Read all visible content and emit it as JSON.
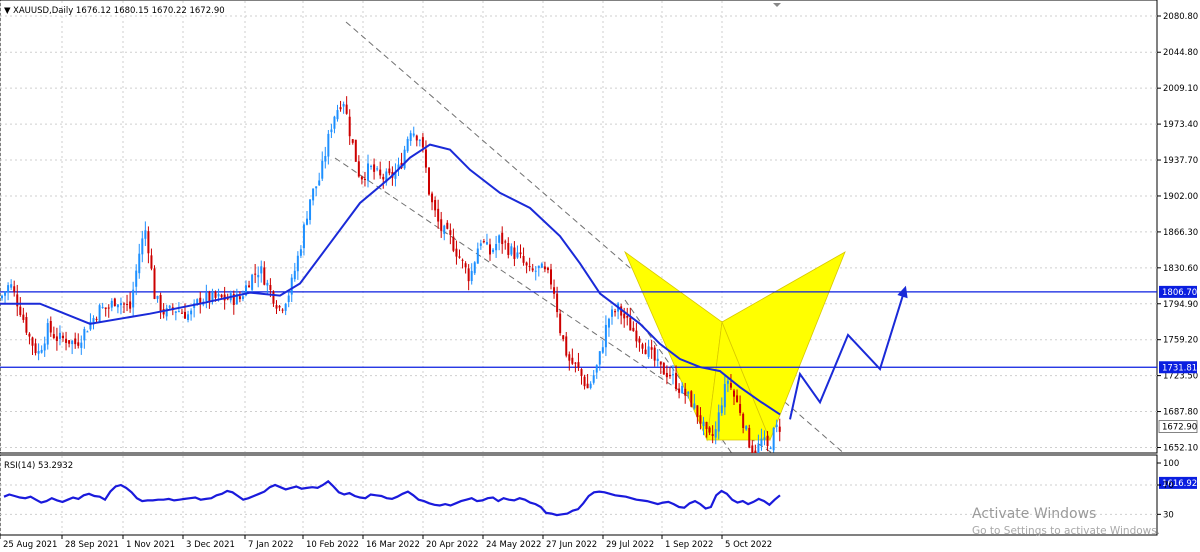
{
  "header": {
    "symbol_line": "XAUUSD,Daily  1676.12 1680.15 1670.22 1672.90",
    "rsi_line": "RSI(14) 53.2932"
  },
  "watermark": {
    "line1": "Activate Windows",
    "line2": "Go to Settings to activate Windows."
  },
  "colors": {
    "bull": "#1e90ff",
    "bear": "#cc0000",
    "ma": "#1a2ad8",
    "hline": "#0a1ee0",
    "pattern": "#ffff00",
    "rsi": "#1a1adc",
    "projection": "#1a2ad8",
    "channel": "#707070"
  },
  "chart_data": [
    {
      "type": "candlestick",
      "symbol": "XAUUSD",
      "timeframe": "Daily",
      "ohlc_last": {
        "open": 1676.12,
        "high": 1680.15,
        "low": 1670.22,
        "close": 1672.9
      },
      "ylim": [
        1616.92,
        2080.8
      ],
      "y_ticks": [
        "2080.80",
        "2044.80",
        "2009.10",
        "1973.40",
        "1937.70",
        "1902.00",
        "1866.30",
        "1830.60",
        "1794.90",
        "1759.20",
        "1723.50",
        "1687.80",
        "1652.10"
      ],
      "x_ticks": [
        "25 Aug 2021",
        "28 Sep 2021",
        "1 Nov 2021",
        "3 Dec 2021",
        "7 Jan 2022",
        "10 Feb 2022",
        "16 Mar 2022",
        "20 Apr 2022",
        "24 May 2022",
        "27 Jun 2022",
        "29 Jul 2022",
        "1 Sep 2022",
        "5 Oct 2022"
      ],
      "close_path": [
        [
          0,
          1800
        ],
        [
          10,
          1815
        ],
        [
          20,
          1790
        ],
        [
          30,
          1760
        ],
        [
          38,
          1745
        ],
        [
          48,
          1770
        ],
        [
          58,
          1760
        ],
        [
          66,
          1760
        ],
        [
          76,
          1755
        ],
        [
          88,
          1773
        ],
        [
          100,
          1790
        ],
        [
          108,
          1790
        ],
        [
          116,
          1800
        ],
        [
          130,
          1790
        ],
        [
          140,
          1850
        ],
        [
          146,
          1870
        ],
        [
          155,
          1800
        ],
        [
          165,
          1785
        ],
        [
          175,
          1790
        ],
        [
          190,
          1783
        ],
        [
          200,
          1800
        ],
        [
          220,
          1800
        ],
        [
          240,
          1800
        ],
        [
          250,
          1820
        ],
        [
          260,
          1830
        ],
        [
          270,
          1808
        ],
        [
          280,
          1790
        ],
        [
          290,
          1808
        ],
        [
          300,
          1850
        ],
        [
          310,
          1900
        ],
        [
          320,
          1920
        ],
        [
          333,
          1980
        ],
        [
          343,
          2000
        ],
        [
          350,
          1965
        ],
        [
          360,
          1920
        ],
        [
          370,
          1930
        ],
        [
          380,
          1920
        ],
        [
          390,
          1920
        ],
        [
          400,
          1930
        ],
        [
          410,
          1970
        ],
        [
          420,
          1960
        ],
        [
          425,
          1935
        ],
        [
          430,
          1900
        ],
        [
          440,
          1870
        ],
        [
          450,
          1860
        ],
        [
          460,
          1840
        ],
        [
          470,
          1820
        ],
        [
          480,
          1860
        ],
        [
          490,
          1845
        ],
        [
          500,
          1860
        ],
        [
          510,
          1848
        ],
        [
          520,
          1840
        ],
        [
          530,
          1825
        ],
        [
          540,
          1830
        ],
        [
          550,
          1820
        ],
        [
          555,
          1805
        ],
        [
          560,
          1770
        ],
        [
          568,
          1740
        ],
        [
          578,
          1730
        ],
        [
          588,
          1710
        ],
        [
          598,
          1735
        ],
        [
          608,
          1780
        ],
        [
          618,
          1790
        ],
        [
          628,
          1775
        ],
        [
          640,
          1760
        ],
        [
          650,
          1745
        ],
        [
          660,
          1730
        ],
        [
          670,
          1725
        ],
        [
          680,
          1710
        ],
        [
          690,
          1700
        ],
        [
          700,
          1680
        ],
        [
          708,
          1660
        ],
        [
          715,
          1665
        ],
        [
          722,
          1700
        ],
        [
          728,
          1720
        ],
        [
          735,
          1700
        ],
        [
          740,
          1690
        ],
        [
          748,
          1660
        ],
        [
          755,
          1645
        ],
        [
          762,
          1660
        ],
        [
          768,
          1650
        ],
        [
          775,
          1670
        ],
        [
          780,
          1672.9
        ]
      ],
      "moving_average_path": [
        [
          0,
          1795
        ],
        [
          40,
          1795
        ],
        [
          90,
          1775
        ],
        [
          150,
          1785
        ],
        [
          200,
          1795
        ],
        [
          250,
          1806
        ],
        [
          280,
          1803
        ],
        [
          300,
          1815
        ],
        [
          330,
          1855
        ],
        [
          360,
          1895
        ],
        [
          390,
          1920
        ],
        [
          410,
          1940
        ],
        [
          430,
          1953
        ],
        [
          450,
          1948
        ],
        [
          470,
          1928
        ],
        [
          500,
          1905
        ],
        [
          530,
          1890
        ],
        [
          560,
          1862
        ],
        [
          580,
          1835
        ],
        [
          600,
          1805
        ],
        [
          620,
          1790
        ],
        [
          640,
          1775
        ],
        [
          660,
          1755
        ],
        [
          680,
          1740
        ],
        [
          700,
          1732
        ],
        [
          720,
          1728
        ],
        [
          740,
          1712
        ],
        [
          760,
          1698
        ],
        [
          780,
          1685
        ]
      ],
      "horizontal_levels": [
        1806.7,
        1731.81,
        1616.92
      ],
      "pattern": "bearish bat / harmonic (yellow)",
      "projection_path": [
        [
          790,
          1680
        ],
        [
          800,
          1725
        ],
        [
          820,
          1697
        ],
        [
          848,
          1764
        ],
        [
          880,
          1730
        ],
        [
          905,
          1810
        ]
      ]
    },
    {
      "type": "line",
      "name": "RSI(14)",
      "last_value": 53.2932,
      "ylim": [
        20,
        100
      ],
      "y_ticks": [
        "100",
        "70",
        "30"
      ],
      "values": [
        54,
        57,
        55,
        53,
        52,
        54,
        50,
        46,
        48,
        52,
        49,
        47,
        50,
        53,
        51,
        56,
        58,
        55,
        54,
        50,
        61,
        68,
        70,
        66,
        60,
        52,
        48,
        49,
        49,
        50,
        50,
        51,
        49,
        50,
        51,
        52,
        53,
        50,
        51,
        52,
        56,
        58,
        62,
        60,
        55,
        50,
        52,
        55,
        58,
        61,
        67,
        70,
        67,
        64,
        66,
        68,
        65,
        66,
        67,
        66,
        70,
        75,
        68,
        60,
        57,
        59,
        55,
        53,
        52,
        57,
        56,
        55,
        52,
        51,
        54,
        58,
        61,
        56,
        50,
        48,
        45,
        43,
        42,
        44,
        42,
        45,
        48,
        50,
        52,
        48,
        49,
        52,
        53,
        48,
        52,
        50,
        49,
        52,
        50,
        46,
        44,
        40,
        32,
        31,
        29,
        30,
        31,
        35,
        37,
        45,
        55,
        60,
        61,
        60,
        58,
        56,
        55,
        54,
        52,
        50,
        49,
        48,
        46,
        44,
        46,
        47,
        44,
        40,
        39,
        45,
        48,
        44,
        38,
        40,
        56,
        62,
        58,
        50,
        46,
        48,
        44,
        47,
        51,
        48,
        43,
        50,
        56
      ]
    }
  ]
}
